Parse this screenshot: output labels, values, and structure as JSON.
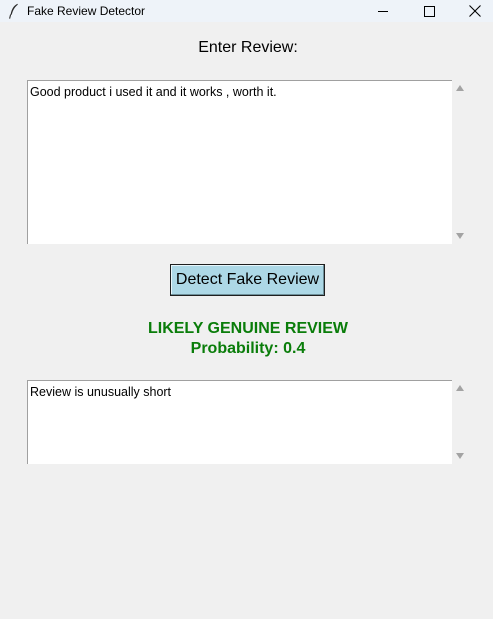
{
  "window": {
    "title": "Fake Review Detector",
    "icon": "feather-icon",
    "controls": [
      "minimize-icon",
      "maximize-icon",
      "close-icon"
    ]
  },
  "input": {
    "label": "Enter Review:",
    "value": "Good product i used it and it works , worth it."
  },
  "action": {
    "detect_label": "Detect Fake Review"
  },
  "result": {
    "verdict": "LIKELY GENUINE REVIEW",
    "probability_text": "Probability: 0.4",
    "color": "#0a7d0a"
  },
  "reasons": {
    "value": "Review is unusually short"
  },
  "colors": {
    "window_bg": "#f0f0f0",
    "button_bg": "#add8e6",
    "result_text": "#0a7d0a"
  }
}
